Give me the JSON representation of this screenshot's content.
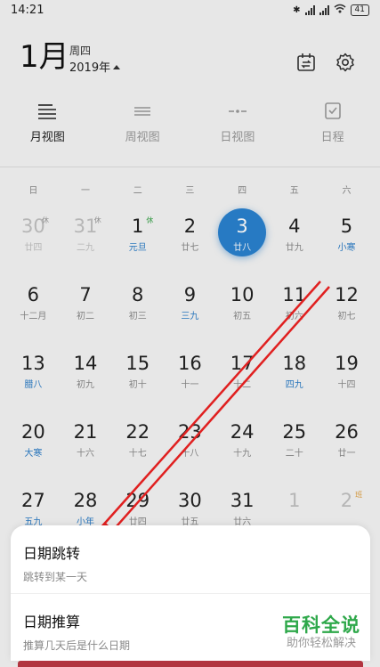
{
  "status": {
    "time": "14:21",
    "battery": "41"
  },
  "header": {
    "month": "1月",
    "weekday": "周四",
    "year": "2019年"
  },
  "views": [
    {
      "label": "月视图",
      "icon": "month-view-icon",
      "active": true
    },
    {
      "label": "周视图",
      "icon": "week-view-icon",
      "active": false
    },
    {
      "label": "日视图",
      "icon": "day-view-icon",
      "active": false
    },
    {
      "label": "日程",
      "icon": "schedule-icon",
      "active": false
    }
  ],
  "weekdays": [
    "日",
    "一",
    "二",
    "三",
    "四",
    "五",
    "六"
  ],
  "weeks": [
    [
      {
        "d": "30",
        "l": "廿四",
        "dim": true,
        "badge": "休"
      },
      {
        "d": "31",
        "l": "二九",
        "dim": true,
        "badge": "休"
      },
      {
        "d": "1",
        "l": "元旦",
        "fest": true,
        "badge": "休",
        "rest": true
      },
      {
        "d": "2",
        "l": "廿七"
      },
      {
        "d": "3",
        "l": "廿八",
        "today": true
      },
      {
        "d": "4",
        "l": "廿九"
      },
      {
        "d": "5",
        "l": "小寒",
        "fest": true
      }
    ],
    [
      {
        "d": "6",
        "l": "十二月"
      },
      {
        "d": "7",
        "l": "初二"
      },
      {
        "d": "8",
        "l": "初三"
      },
      {
        "d": "9",
        "l": "三九",
        "fest": true
      },
      {
        "d": "10",
        "l": "初五"
      },
      {
        "d": "11",
        "l": "初六"
      },
      {
        "d": "12",
        "l": "初七"
      }
    ],
    [
      {
        "d": "13",
        "l": "腊八",
        "fest": true
      },
      {
        "d": "14",
        "l": "初九"
      },
      {
        "d": "15",
        "l": "初十"
      },
      {
        "d": "16",
        "l": "十一"
      },
      {
        "d": "17",
        "l": "十二"
      },
      {
        "d": "18",
        "l": "四九",
        "fest": true
      },
      {
        "d": "19",
        "l": "十四"
      }
    ],
    [
      {
        "d": "20",
        "l": "大寒",
        "fest": true
      },
      {
        "d": "21",
        "l": "十六"
      },
      {
        "d": "22",
        "l": "十七"
      },
      {
        "d": "23",
        "l": "十八"
      },
      {
        "d": "24",
        "l": "十九"
      },
      {
        "d": "25",
        "l": "二十"
      },
      {
        "d": "26",
        "l": "廿一"
      }
    ],
    [
      {
        "d": "27",
        "l": "五九",
        "fest": true
      },
      {
        "d": "28",
        "l": "小年",
        "fest": true
      },
      {
        "d": "29",
        "l": "廿四"
      },
      {
        "d": "30",
        "l": "廿五"
      },
      {
        "d": "31",
        "l": "廿六"
      },
      {
        "d": "1",
        "l": "",
        "dim": true
      },
      {
        "d": "2",
        "l": "",
        "dim": true,
        "badge": "班",
        "work": true
      }
    ]
  ],
  "sheet": [
    {
      "title": "日期跳转",
      "subtitle": "跳转到某一天"
    },
    {
      "title": "日期推算",
      "subtitle": "推算几天后是什么日期"
    }
  ],
  "watermark": {
    "title": "百科全说",
    "subtitle": "助你轻松解决"
  },
  "colors": {
    "accent": "#2a82d0",
    "festival": "#2a7cc7",
    "arrow": "#e02020",
    "watermark": "#2ea84a"
  }
}
